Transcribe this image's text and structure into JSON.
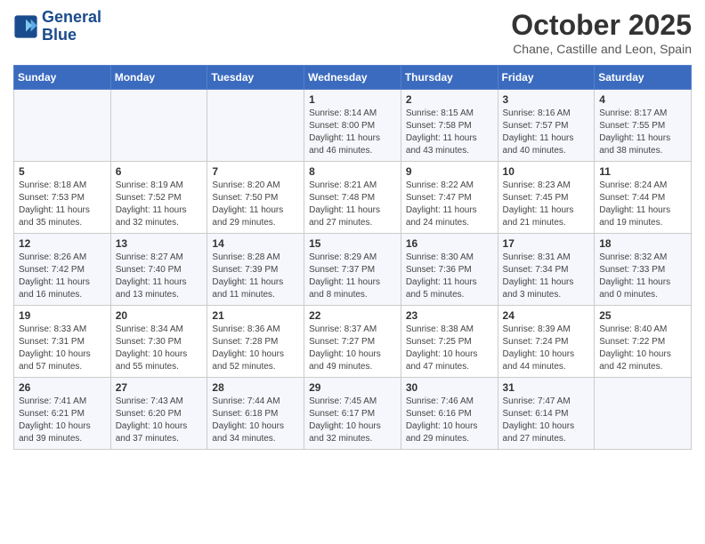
{
  "header": {
    "logo_line1": "General",
    "logo_line2": "Blue",
    "month": "October 2025",
    "location": "Chane, Castille and Leon, Spain"
  },
  "days_of_week": [
    "Sunday",
    "Monday",
    "Tuesday",
    "Wednesday",
    "Thursday",
    "Friday",
    "Saturday"
  ],
  "weeks": [
    [
      {
        "day": "",
        "info": ""
      },
      {
        "day": "",
        "info": ""
      },
      {
        "day": "",
        "info": ""
      },
      {
        "day": "1",
        "info": "Sunrise: 8:14 AM\nSunset: 8:00 PM\nDaylight: 11 hours\nand 46 minutes."
      },
      {
        "day": "2",
        "info": "Sunrise: 8:15 AM\nSunset: 7:58 PM\nDaylight: 11 hours\nand 43 minutes."
      },
      {
        "day": "3",
        "info": "Sunrise: 8:16 AM\nSunset: 7:57 PM\nDaylight: 11 hours\nand 40 minutes."
      },
      {
        "day": "4",
        "info": "Sunrise: 8:17 AM\nSunset: 7:55 PM\nDaylight: 11 hours\nand 38 minutes."
      }
    ],
    [
      {
        "day": "5",
        "info": "Sunrise: 8:18 AM\nSunset: 7:53 PM\nDaylight: 11 hours\nand 35 minutes."
      },
      {
        "day": "6",
        "info": "Sunrise: 8:19 AM\nSunset: 7:52 PM\nDaylight: 11 hours\nand 32 minutes."
      },
      {
        "day": "7",
        "info": "Sunrise: 8:20 AM\nSunset: 7:50 PM\nDaylight: 11 hours\nand 29 minutes."
      },
      {
        "day": "8",
        "info": "Sunrise: 8:21 AM\nSunset: 7:48 PM\nDaylight: 11 hours\nand 27 minutes."
      },
      {
        "day": "9",
        "info": "Sunrise: 8:22 AM\nSunset: 7:47 PM\nDaylight: 11 hours\nand 24 minutes."
      },
      {
        "day": "10",
        "info": "Sunrise: 8:23 AM\nSunset: 7:45 PM\nDaylight: 11 hours\nand 21 minutes."
      },
      {
        "day": "11",
        "info": "Sunrise: 8:24 AM\nSunset: 7:44 PM\nDaylight: 11 hours\nand 19 minutes."
      }
    ],
    [
      {
        "day": "12",
        "info": "Sunrise: 8:26 AM\nSunset: 7:42 PM\nDaylight: 11 hours\nand 16 minutes."
      },
      {
        "day": "13",
        "info": "Sunrise: 8:27 AM\nSunset: 7:40 PM\nDaylight: 11 hours\nand 13 minutes."
      },
      {
        "day": "14",
        "info": "Sunrise: 8:28 AM\nSunset: 7:39 PM\nDaylight: 11 hours\nand 11 minutes."
      },
      {
        "day": "15",
        "info": "Sunrise: 8:29 AM\nSunset: 7:37 PM\nDaylight: 11 hours\nand 8 minutes."
      },
      {
        "day": "16",
        "info": "Sunrise: 8:30 AM\nSunset: 7:36 PM\nDaylight: 11 hours\nand 5 minutes."
      },
      {
        "day": "17",
        "info": "Sunrise: 8:31 AM\nSunset: 7:34 PM\nDaylight: 11 hours\nand 3 minutes."
      },
      {
        "day": "18",
        "info": "Sunrise: 8:32 AM\nSunset: 7:33 PM\nDaylight: 11 hours\nand 0 minutes."
      }
    ],
    [
      {
        "day": "19",
        "info": "Sunrise: 8:33 AM\nSunset: 7:31 PM\nDaylight: 10 hours\nand 57 minutes."
      },
      {
        "day": "20",
        "info": "Sunrise: 8:34 AM\nSunset: 7:30 PM\nDaylight: 10 hours\nand 55 minutes."
      },
      {
        "day": "21",
        "info": "Sunrise: 8:36 AM\nSunset: 7:28 PM\nDaylight: 10 hours\nand 52 minutes."
      },
      {
        "day": "22",
        "info": "Sunrise: 8:37 AM\nSunset: 7:27 PM\nDaylight: 10 hours\nand 49 minutes."
      },
      {
        "day": "23",
        "info": "Sunrise: 8:38 AM\nSunset: 7:25 PM\nDaylight: 10 hours\nand 47 minutes."
      },
      {
        "day": "24",
        "info": "Sunrise: 8:39 AM\nSunset: 7:24 PM\nDaylight: 10 hours\nand 44 minutes."
      },
      {
        "day": "25",
        "info": "Sunrise: 8:40 AM\nSunset: 7:22 PM\nDaylight: 10 hours\nand 42 minutes."
      }
    ],
    [
      {
        "day": "26",
        "info": "Sunrise: 7:41 AM\nSunset: 6:21 PM\nDaylight: 10 hours\nand 39 minutes."
      },
      {
        "day": "27",
        "info": "Sunrise: 7:43 AM\nSunset: 6:20 PM\nDaylight: 10 hours\nand 37 minutes."
      },
      {
        "day": "28",
        "info": "Sunrise: 7:44 AM\nSunset: 6:18 PM\nDaylight: 10 hours\nand 34 minutes."
      },
      {
        "day": "29",
        "info": "Sunrise: 7:45 AM\nSunset: 6:17 PM\nDaylight: 10 hours\nand 32 minutes."
      },
      {
        "day": "30",
        "info": "Sunrise: 7:46 AM\nSunset: 6:16 PM\nDaylight: 10 hours\nand 29 minutes."
      },
      {
        "day": "31",
        "info": "Sunrise: 7:47 AM\nSunset: 6:14 PM\nDaylight: 10 hours\nand 27 minutes."
      },
      {
        "day": "",
        "info": ""
      }
    ]
  ]
}
